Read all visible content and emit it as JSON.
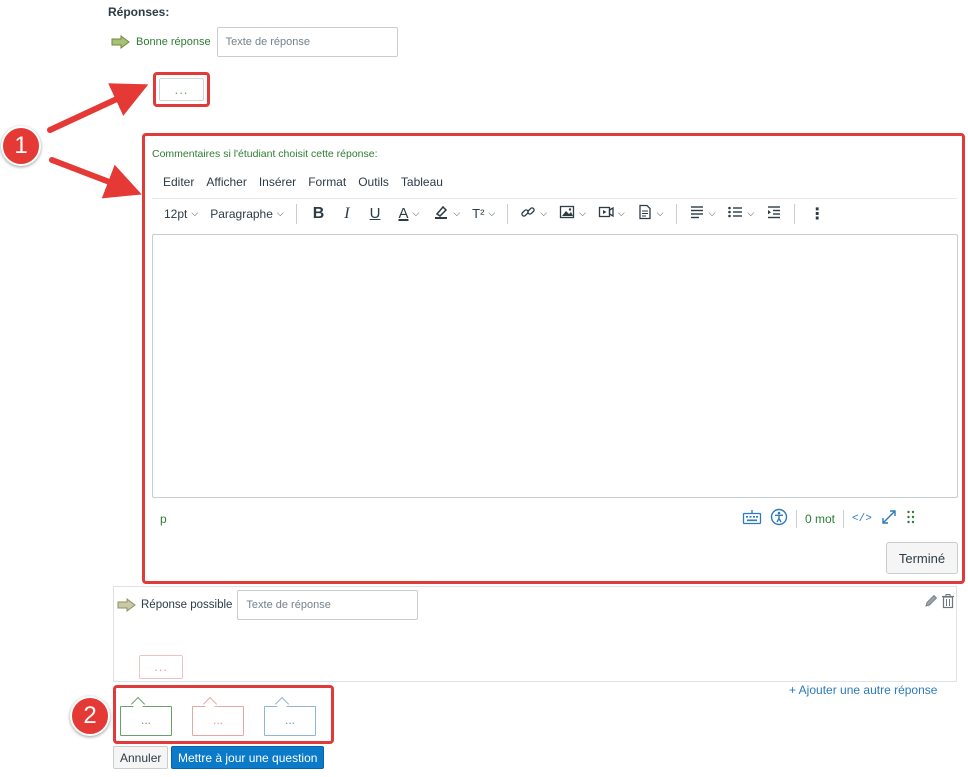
{
  "responses": {
    "label": "Réponses:",
    "correct": {
      "label": "Bonne réponse",
      "placeholder": "Texte de réponse"
    },
    "comment_button": "..."
  },
  "callouts": {
    "one": "1",
    "two": "2"
  },
  "editor": {
    "comments_title": "Commentaires si l'étudiant choisit cette réponse:",
    "menu": [
      "Editer",
      "Afficher",
      "Insérer",
      "Format",
      "Outils",
      "Tableau"
    ],
    "toolbar": {
      "font_size": "12pt",
      "block_format": "Paragraphe",
      "bold": "B",
      "italic": "I",
      "underline": "U",
      "text_color": "A",
      "superscript": "T²",
      "more": "⋮"
    },
    "status": {
      "path": "p",
      "word_count": "0 mot",
      "html_toggle": "</>"
    },
    "done_button": "Terminé"
  },
  "possible": {
    "label": "Réponse possible",
    "placeholder": "Texte de réponse",
    "comment_button": "..."
  },
  "add_answer": "+ Ajouter une autre réponse",
  "feedback_tabs": [
    {
      "label": "...",
      "color": "#6aa06d"
    },
    {
      "label": "...",
      "color": "#e39a9a"
    },
    {
      "label": "...",
      "color": "#5b9bd5"
    }
  ],
  "actions": {
    "cancel": "Annuler",
    "update": "Mettre à jour une question"
  },
  "colors": {
    "callout_red": "#e53935",
    "accent_green": "#2e7d32",
    "primary_blue": "#0a7ac9"
  }
}
